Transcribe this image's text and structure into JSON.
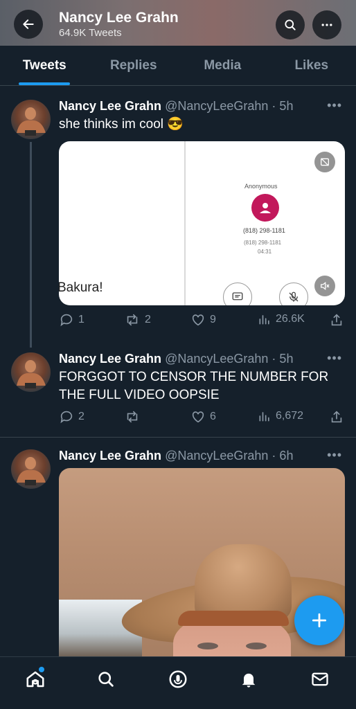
{
  "header": {
    "back_icon": "arrow-left-icon",
    "name": "Nancy Lee Grahn",
    "tweet_count": "64.9K Tweets",
    "search_icon": "search-icon",
    "more_icon": "more-horizontal-icon"
  },
  "tabs": [
    {
      "label": "Tweets",
      "active": true
    },
    {
      "label": "Replies",
      "active": false
    },
    {
      "label": "Media",
      "active": false
    },
    {
      "label": "Likes",
      "active": false
    }
  ],
  "tweets": [
    {
      "name": "Nancy Lee Grahn",
      "meta": "@NancyLeeGrahn · 5h",
      "text": "she thinks im cool 😎",
      "media": {
        "left_text": "Bakura!",
        "caller": "Anonymous",
        "number": "(818) 298-1181",
        "number_small": "(818) 298-1181",
        "time": "04:31"
      },
      "replies": "1",
      "retweets": "2",
      "likes": "9",
      "views": "26.6K"
    },
    {
      "name": "Nancy Lee Grahn",
      "meta": "@NancyLeeGrahn · 5h",
      "text": "FORGGOT TO CENSOR THE NUMBER FOR THE FULL VIDEO OOPSIE",
      "replies": "2",
      "retweets": "",
      "likes": "6",
      "views": "6,672"
    },
    {
      "name": "Nancy Lee Grahn",
      "meta": "@NancyLeeGrahn · 6h"
    }
  ],
  "more_label": "•••",
  "fab_icon": "compose-plus-icon",
  "nav": [
    "home-icon",
    "search-icon",
    "spaces-icon",
    "notifications-icon",
    "messages-icon"
  ],
  "colors": {
    "background": "#15202b",
    "accent": "#1d9bf0",
    "muted": "#8b98a5",
    "border": "#38444d"
  }
}
